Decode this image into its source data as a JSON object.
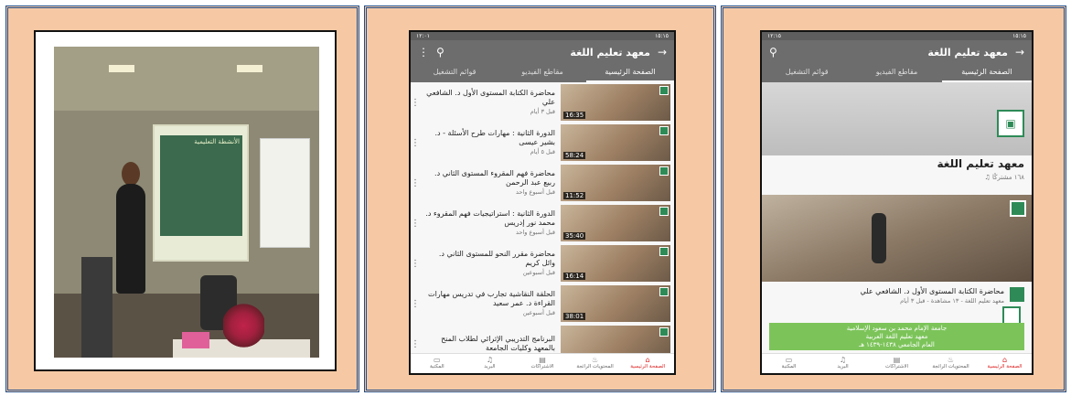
{
  "panel2": {
    "status_left": "١٢:٠١",
    "status_right": "١٥:١٥",
    "title": "معهد تعليم اللغة",
    "tabs": [
      "الصفحة الرئيسية",
      "مقاطع الفيديو",
      "قوائم التشغيل"
    ],
    "videos": [
      {
        "title": "محاضرة الكتابة المستوى الأول د. الشافعي علي",
        "meta": "قبل ٣ أيام",
        "duration": "16:35"
      },
      {
        "title": "الدورة الثانية : مهارات طرح الأسئلة - د. بشير عيسى",
        "meta": "قبل ٥ أيام",
        "duration": "58:24"
      },
      {
        "title": "محاضرة فهم المقروء المستوى الثاني د. ربيع عبد الرحمن",
        "meta": "قبل أسبوع واحد",
        "duration": "11:52"
      },
      {
        "title": "الدورة الثانية : استراتيجيات فهم المقروء د. محمد نور إدريس",
        "meta": "قبل أسبوع واحد",
        "duration": "35:40"
      },
      {
        "title": "محاضرة مقرر النحو للمستوى الثاني د. وائل كريم",
        "meta": "قبل أسبوعين",
        "duration": "16:14"
      },
      {
        "title": "الحلقة النقاشية تجارب في تدريس مهارات القراءة د. عمر سعيد",
        "meta": "قبل أسبوعين",
        "duration": "38:01"
      },
      {
        "title": "البرنامج التدريبي الإثرائي لطلاب المنح بالمعهد وكليات الجامعة",
        "meta": "",
        "duration": ""
      }
    ],
    "nav": [
      "الصفحة الرئيسية",
      "المحتويات الرائجة",
      "الاشتراكات",
      "البريد",
      "المكتبة"
    ]
  },
  "panel3": {
    "status_left": "١٢:١٥",
    "status_right": "١٥:١٥",
    "title": "معهد تعليم اللغة",
    "tabs": [
      "الصفحة الرئيسية",
      "مقاطع الفيديو",
      "قوائم التشغيل"
    ],
    "channel_name": "معهد تعليم اللغة",
    "subscribers": "١٦٨ مشتركًا",
    "video_title": "محاضرة الكتابة المستوى الأول د. الشافعي علي",
    "video_meta": "معهد تعليم اللغة - ١٣ مشاهدة - قبل ٣ أيام",
    "banner_lines": [
      "جامعة الإمام محمد بن سعود الإسلامية",
      "معهد تعليم اللغة العربية",
      "العام الجامعي ١٤٣٨-١٤٣٩ هـ"
    ],
    "nav": [
      "الصفحة الرئيسية",
      "المحتويات الرائجة",
      "الاشتراكات",
      "البريد",
      "المكتبة"
    ]
  },
  "photo": {
    "slide_title": "الأنشطة التعليمية"
  }
}
